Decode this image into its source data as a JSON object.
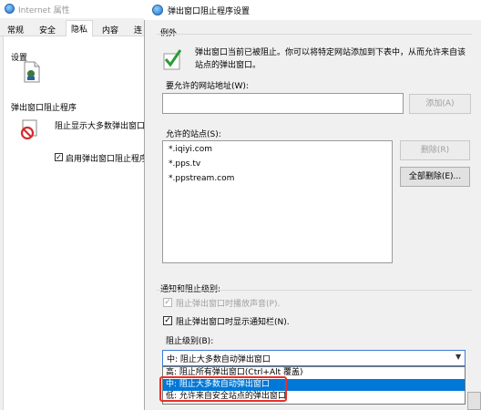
{
  "background_window": {
    "title": "Internet 属性",
    "tabs": [
      "常规",
      "安全",
      "隐私",
      "内容",
      "连"
    ],
    "active_tab_index": 2,
    "settings_label": "设置",
    "popup_blocker_heading": "弹出窗口阻止程序",
    "popup_blocker_desc": "阻止显示大多数弹出窗口",
    "enable_checkbox": {
      "label": "启用弹出窗口阻止程序",
      "checked": true
    }
  },
  "dialog": {
    "title": "弹出窗口阻止程序设置",
    "exceptions_label": "例外",
    "description": "弹出窗口当前已被阻止。你可以将特定网站添加到下表中，从而允许来自该站点的弹出窗口。",
    "address_label": "要允许的网站地址(W):",
    "address_value": "",
    "add_button": "添加(A)",
    "allowed_sites_label": "允许的站点(S):",
    "allowed_sites": [
      "*.iqiyi.com",
      "*.pps.tv",
      "*.ppstream.com"
    ],
    "remove_button": "删除(R)",
    "remove_all_button": "全部删除(E)...",
    "notifications_label": "通知和阻止级别:",
    "sound_checkbox": {
      "label": "阻止弹出窗口时播放声音(P).",
      "checked": true,
      "disabled": true
    },
    "infobar_checkbox": {
      "label": "阻止弹出窗口时显示通知栏(N).",
      "checked": true
    },
    "block_level_label": "阻止级别(B):",
    "block_level_selected": "中: 阻止大多数自动弹出窗口",
    "block_level_options": [
      "高: 阻止所有弹出窗口(Ctrl+Alt 覆盖)",
      "中: 阻止大多数自动弹出窗口",
      "低: 允许来自安全站点的弹出窗口"
    ],
    "highlighted_option_index": 1
  },
  "colors": {
    "dialog_bg": "#f0f0f0",
    "selection_blue": "#0078d7",
    "highlight_red": "#e8302a"
  }
}
